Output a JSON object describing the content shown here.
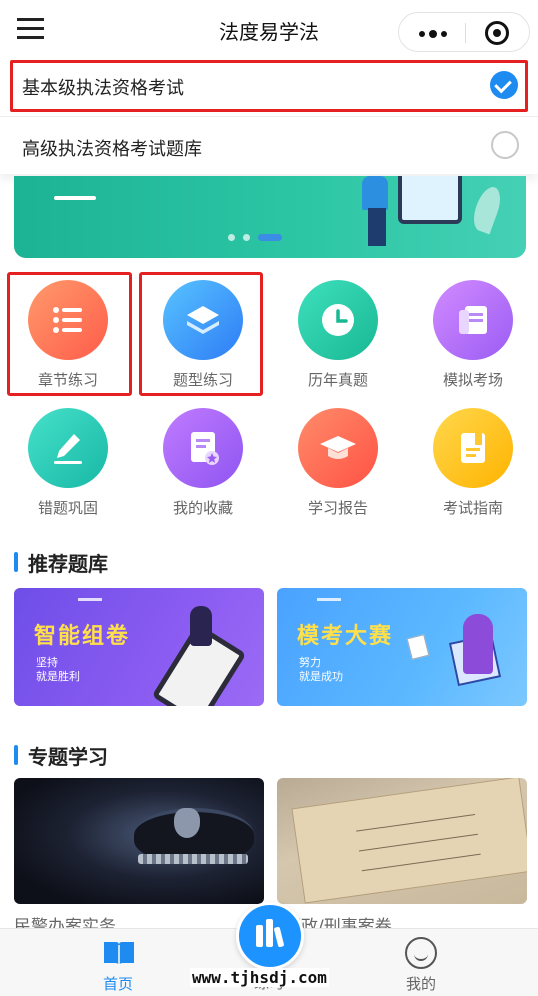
{
  "header": {
    "title": "法度易学法"
  },
  "options": [
    {
      "label": "基本级执法资格考试",
      "selected": true
    },
    {
      "label": "高级执法资格考试题库",
      "selected": false
    }
  ],
  "grid": [
    {
      "label": "章节练习",
      "icon": "list-icon"
    },
    {
      "label": "题型练习",
      "icon": "layers-icon"
    },
    {
      "label": "历年真题",
      "icon": "clock-icon"
    },
    {
      "label": "模拟考场",
      "icon": "scroll-icon"
    },
    {
      "label": "错题巩固",
      "icon": "pencil-icon"
    },
    {
      "label": "我的收藏",
      "icon": "favorite-doc-icon"
    },
    {
      "label": "学习报告",
      "icon": "graduation-cap-icon"
    },
    {
      "label": "考试指南",
      "icon": "guide-book-icon"
    }
  ],
  "sections": {
    "recommended": "推荐题库",
    "topics": "专题学习"
  },
  "recommended": [
    {
      "title": "智能组卷",
      "line1": "坚持",
      "line2": "就是胜利"
    },
    {
      "title": "模考大赛",
      "line1": "努力",
      "line2": "就是成功"
    }
  ],
  "topics": [
    {
      "label": "民警办案实务"
    },
    {
      "label": "行政/刑事案卷"
    }
  ],
  "tabbar": {
    "home": "首页",
    "practice": "练习",
    "me": "我的"
  },
  "watermark": "www.tjhsdj.com",
  "colors": {
    "accent": "#1e8bf0",
    "highlight_frame": "#e52020"
  }
}
